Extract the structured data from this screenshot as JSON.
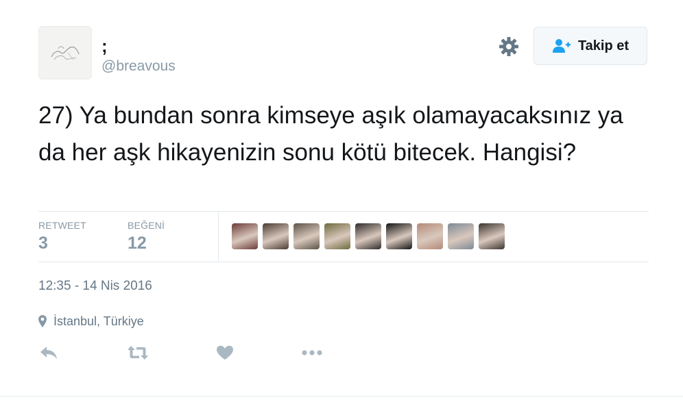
{
  "author": {
    "name": ";",
    "handle": "@breavous",
    "avatar_icon": "sketch-avatar-icon"
  },
  "follow_button": {
    "label": "Takip et",
    "icon": "add-user-icon",
    "icon_color": "#1da1f2"
  },
  "settings_icon": "gear-icon",
  "tweet": {
    "text": "27) Ya bundan sonra kimseye aşık olamayacaksınız ya da her aşk hikayenizin sonu kötü bitecek. Hangisi?"
  },
  "stats": {
    "retweet_label": "RETWEET",
    "retweet_count": "3",
    "like_label": "BEĞENİ",
    "like_count": "12"
  },
  "likers": [
    {
      "avatar": "profile-photo-1",
      "color": "#6b3b3a"
    },
    {
      "avatar": "profile-photo-2",
      "color": "#4a3a30"
    },
    {
      "avatar": "profile-photo-3",
      "color": "#5c5346"
    },
    {
      "avatar": "profile-photo-4",
      "color": "#6e6a3e"
    },
    {
      "avatar": "profile-photo-5",
      "color": "#2f2b2a"
    },
    {
      "avatar": "profile-photo-6",
      "color": "#141414"
    },
    {
      "avatar": "profile-photo-7",
      "color": "#b48a78"
    },
    {
      "avatar": "profile-photo-8",
      "color": "#7e8a96"
    },
    {
      "avatar": "profile-photo-9",
      "color": "#3d3530"
    }
  ],
  "timestamp": "12:35 - 14 Nis 2016",
  "location": {
    "icon": "location-pin-icon",
    "text": "İstanbul, Türkiye"
  },
  "actions": [
    "reply-icon",
    "retweet-icon",
    "like-icon",
    "more-icon"
  ],
  "colors": {
    "text_primary": "#14171a",
    "text_muted": "#8899a6",
    "border": "#e1e8ed",
    "action_icon": "#aab8c2"
  }
}
